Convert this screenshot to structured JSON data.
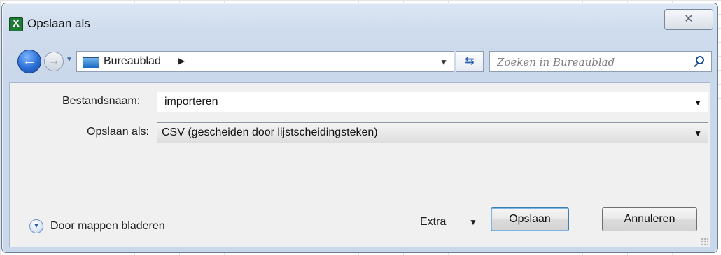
{
  "window": {
    "title": "Opslaan als",
    "app_icon_letter": "X",
    "close_glyph": "✕"
  },
  "nav": {
    "back_glyph": "←",
    "forward_glyph": "→",
    "location": "Bureaublad",
    "refresh_glyph": "⇆"
  },
  "search": {
    "placeholder": "Zoeken in Bureaublad"
  },
  "form": {
    "filename_label": "Bestandsnaam:",
    "filename_value": "importeren",
    "type_label": "Opslaan als:",
    "type_value": "CSV (gescheiden door lijstscheidingsteken)"
  },
  "footer": {
    "browse_label": "Door mappen bladeren",
    "extra_label": "Extra",
    "save_label": "Opslaan",
    "cancel_label": "Annuleren"
  },
  "colors": {
    "dialog_bg": "#c9d8ea",
    "accent": "#2a6fd6",
    "excel_green": "#1f7a35"
  }
}
